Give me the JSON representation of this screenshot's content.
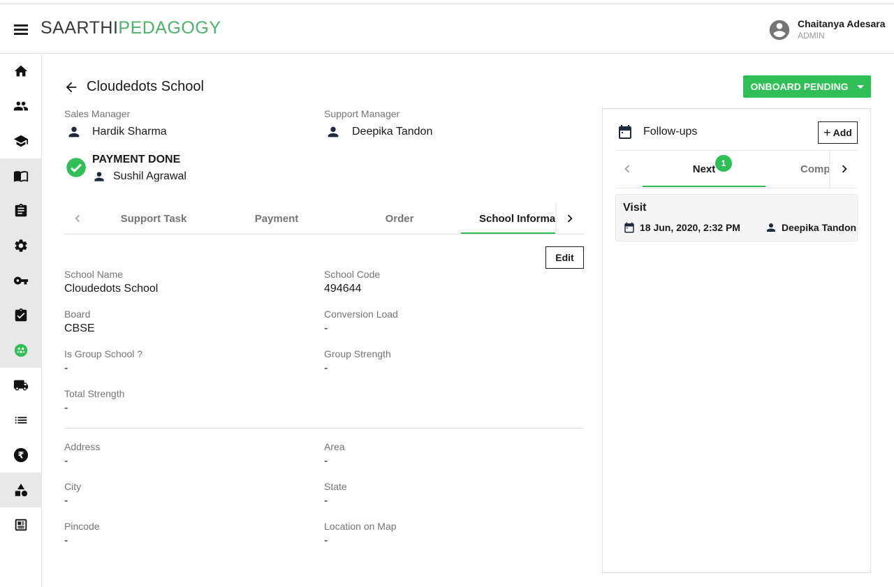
{
  "app": {
    "logo_part1": "SAARTHI",
    "logo_part2": "PEDAGOGY",
    "brand_color": "#4db36a",
    "accent_color": "#2fbf56"
  },
  "user": {
    "name": "Chaitanya Adesara",
    "role": "ADMIN"
  },
  "sidebar": {
    "items": [
      {
        "icon": "home-icon"
      },
      {
        "icon": "people-icon"
      },
      {
        "icon": "school-icon"
      },
      {
        "icon": "book-icon"
      },
      {
        "icon": "clipboard-icon"
      },
      {
        "icon": "settings-icon"
      },
      {
        "icon": "key-icon"
      },
      {
        "icon": "assignment-check-icon"
      },
      {
        "icon": "community-icon"
      },
      {
        "icon": "truck-icon"
      },
      {
        "icon": "list-icon"
      },
      {
        "icon": "rupee-icon"
      },
      {
        "icon": "shapes-icon"
      },
      {
        "icon": "newspaper-icon"
      }
    ]
  },
  "page": {
    "title": "Cloudedots School",
    "status_button": "ONBOARD PENDING",
    "sales_manager": {
      "label": "Sales Manager",
      "name": "Hardik Sharma"
    },
    "support_manager": {
      "label": "Support Manager",
      "name": "Deepika Tandon"
    },
    "payment": {
      "status": "PAYMENT DONE",
      "person": "Sushil Agrawal"
    }
  },
  "tabs": [
    "Support Task",
    "Payment",
    "Order",
    "School Informat"
  ],
  "active_tab": "School Informat",
  "edit_label": "Edit",
  "fields": {
    "school_name": {
      "label": "School Name",
      "value": "Cloudedots School"
    },
    "school_code": {
      "label": "School Code",
      "value": "494644"
    },
    "board": {
      "label": "Board",
      "value": "CBSE"
    },
    "conversion_load": {
      "label": "Conversion Load",
      "value": "-"
    },
    "is_group_school": {
      "label": "Is Group School ?",
      "value": "-"
    },
    "group_strength": {
      "label": "Group Strength",
      "value": "-"
    },
    "total_strength": {
      "label": "Total Strength",
      "value": "-"
    },
    "address": {
      "label": "Address",
      "value": "-"
    },
    "area": {
      "label": "Area",
      "value": "-"
    },
    "city": {
      "label": "City",
      "value": "-"
    },
    "state": {
      "label": "State",
      "value": "-"
    },
    "pincode": {
      "label": "Pincode",
      "value": "-"
    },
    "location_on_map": {
      "label": "Location on Map",
      "value": "-"
    }
  },
  "followups": {
    "title": "Follow-ups",
    "add_label": "Add",
    "tabs": [
      "Next",
      "Comp"
    ],
    "next_count": "1",
    "items": [
      {
        "type": "Visit",
        "date": "18 Jun, 2020, 2:32 PM",
        "person": "Deepika Tandon"
      }
    ]
  }
}
